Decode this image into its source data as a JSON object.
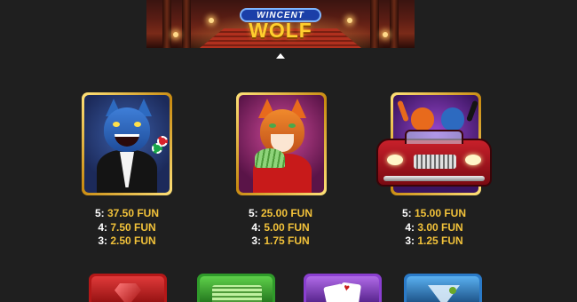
{
  "logo": {
    "line1": "WINCENT",
    "line2": "WOLF"
  },
  "symbols": [
    {
      "name": "wolf",
      "pays": [
        {
          "count": "5:",
          "amount": "37.50 FUN"
        },
        {
          "count": "4:",
          "amount": "7.50 FUN"
        },
        {
          "count": "3:",
          "amount": "2.50 FUN"
        }
      ]
    },
    {
      "name": "fox",
      "pays": [
        {
          "count": "5:",
          "amount": "25.00 FUN"
        },
        {
          "count": "4:",
          "amount": "5.00 FUN"
        },
        {
          "count": "3:",
          "amount": "1.75 FUN"
        }
      ]
    },
    {
      "name": "car",
      "pays": [
        {
          "count": "5:",
          "amount": "15.00 FUN"
        },
        {
          "count": "4:",
          "amount": "3.00 FUN"
        },
        {
          "count": "3:",
          "amount": "1.25 FUN"
        }
      ]
    }
  ],
  "bottom_symbols": [
    "ruby-icon",
    "cash-stack-icon",
    "playing-cards-icon",
    "martini-icon"
  ],
  "colors": {
    "background": "#1f1f1f",
    "payout_amount": "#f2c23a",
    "tile_border": "#e8b640"
  }
}
